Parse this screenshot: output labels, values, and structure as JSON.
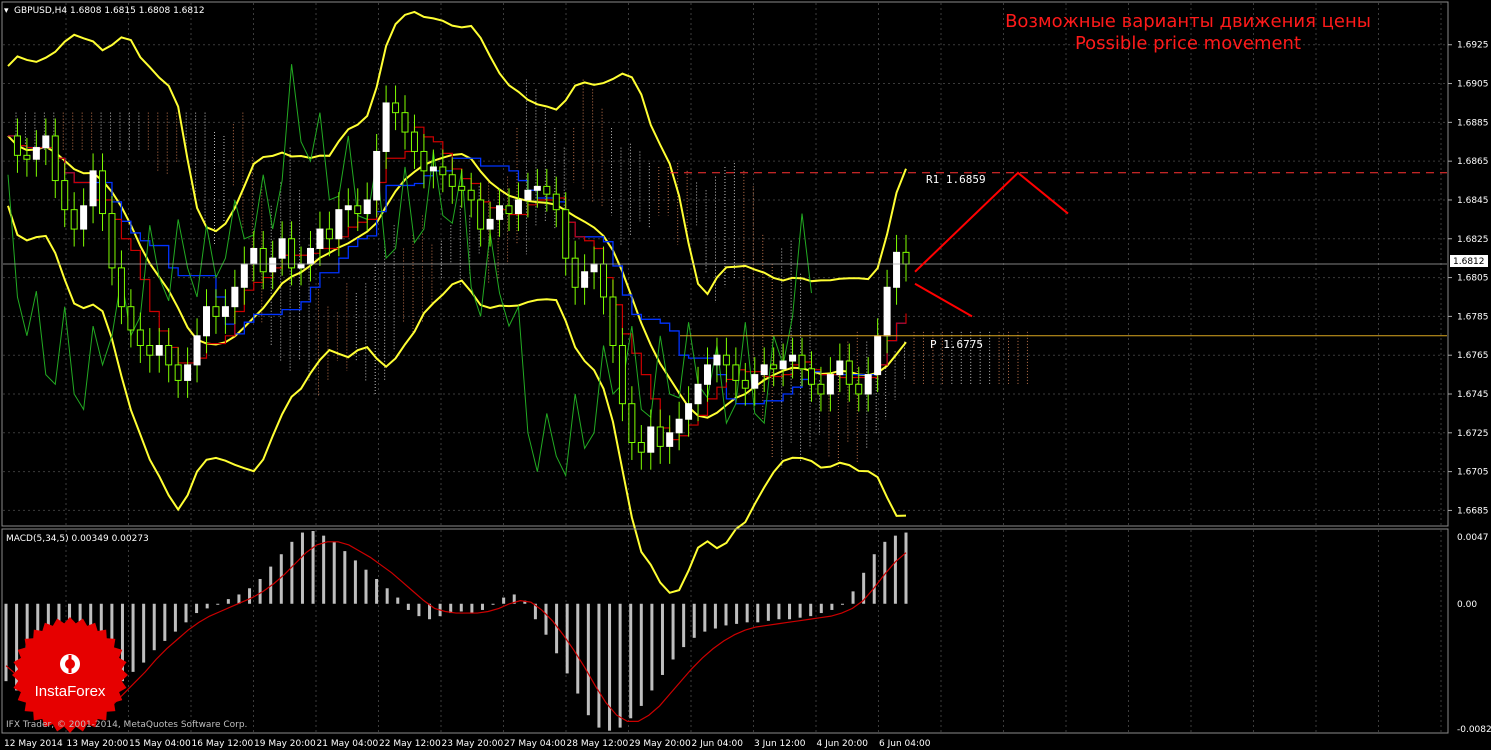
{
  "symbol_header": "GBPUSD,H4  1.6808 1.6815 1.6808 1.6812",
  "annotation": {
    "line1": "Возможные варианты движения цены",
    "line2": "Possible price movement"
  },
  "levels": [
    {
      "label": "R1 1.6859",
      "value": 1.6859,
      "color": "#ff3333",
      "style": "dashed"
    },
    {
      "label": "P 1.6775",
      "value": 1.6775,
      "color": "#d9a520",
      "style": "solid"
    }
  ],
  "current_price": {
    "label": "1.6812",
    "value": 1.6812
  },
  "macd_header": "MACD(5,34,5) 0.00349 0.00273",
  "copyright": "IFX Trader, © 2001-2014, MetaQuotes Software Corp.",
  "logo_text": "InstaForex",
  "price_axis": [
    "1.6925",
    "1.6905",
    "1.6885",
    "1.6865",
    "1.6845",
    "1.6825",
    "1.6805",
    "1.6785",
    "1.6765",
    "1.6745",
    "1.6725",
    "1.6705",
    "1.6685"
  ],
  "macd_axis": [
    "0.0047",
    "0.00",
    "-0.00822"
  ],
  "time_axis": [
    "12 May 2014",
    "13 May 20:00",
    "15 May 04:00",
    "16 May 12:00",
    "19 May 20:00",
    "21 May 04:00",
    "22 May 12:00",
    "23 May 20:00",
    "27 May 04:00",
    "28 May 12:00",
    "29 May 20:00",
    "2 Jun 04:00",
    "3 Jun 12:00",
    "4 Jun 20:00",
    "6 Jun 04:00"
  ],
  "colors": {
    "background": "#000000",
    "grid": "#3b3b3b",
    "bull": "#ffffff",
    "bear": "#7fff00",
    "bollinger": "#ffff33",
    "kijun": "#0033ff",
    "tenkan": "#cc0000",
    "chikou": "#22aa22",
    "macd_hist": "#bfbfbf",
    "macd_signal": "#cc0000",
    "annotation": "#ff1a1a",
    "logo": "#e60000"
  },
  "chart_data": {
    "type": "candlestick",
    "price_ylim": [
      1.6678,
      1.6946
    ],
    "macd_ylim": [
      -0.00822,
      0.0047
    ],
    "price_series": [
      1.6878,
      1.6868,
      1.6866,
      1.6872,
      1.6878,
      1.6855,
      1.684,
      1.683,
      1.6842,
      1.686,
      1.6838,
      1.681,
      1.679,
      1.6778,
      1.677,
      1.6765,
      1.677,
      1.676,
      1.6752,
      1.676,
      1.6775,
      1.679,
      1.6785,
      1.679,
      1.68,
      1.6812,
      1.682,
      1.6808,
      1.6815,
      1.6825,
      1.681,
      1.6812,
      1.682,
      1.683,
      1.6825,
      1.684,
      1.6842,
      1.6838,
      1.6845,
      1.687,
      1.6895,
      1.689,
      1.688,
      1.687,
      1.686,
      1.6862,
      1.6858,
      1.6852,
      1.685,
      1.6845,
      1.683,
      1.6835,
      1.6842,
      1.6838,
      1.6845,
      1.685,
      1.6852,
      1.6848,
      1.684,
      1.6815,
      1.68,
      1.6808,
      1.6812,
      1.6795,
      1.677,
      1.674,
      1.672,
      1.6715,
      1.6728,
      1.6718,
      1.6725,
      1.6732,
      1.674,
      1.675,
      1.676,
      1.6765,
      1.676,
      1.6752,
      1.6748,
      1.6755,
      1.676,
      1.6758,
      1.6762,
      1.6765,
      1.6758,
      1.675,
      1.6745,
      1.6755,
      1.6762,
      1.675,
      1.6745,
      1.6755,
      1.6775,
      1.68,
      1.6818,
      1.6812
    ],
    "macd_histogram": [
      -0.005,
      -0.0056,
      -0.0058,
      -0.0062,
      -0.0066,
      -0.0068,
      -0.0072,
      -0.0074,
      -0.007,
      -0.0064,
      -0.0058,
      -0.005,
      -0.0044,
      -0.0038,
      -0.003,
      -0.0024,
      -0.0018,
      -0.0012,
      -0.0006,
      -0.0003,
      0.0,
      0.0003,
      0.0006,
      0.001,
      0.0016,
      0.0024,
      0.0032,
      0.004,
      0.0046,
      0.0047,
      0.0044,
      0.004,
      0.0034,
      0.0028,
      0.0022,
      0.0016,
      0.001,
      0.0004,
      -0.0004,
      -0.0008,
      -0.001,
      -0.0008,
      -0.0006,
      -0.0005,
      -0.0006,
      -0.0004,
      0.0,
      0.0004,
      0.0006,
      0.0002,
      -0.001,
      -0.002,
      -0.0032,
      -0.0045,
      -0.0058,
      -0.0072,
      -0.008,
      -0.0082,
      -0.008,
      -0.0074,
      -0.0066,
      -0.0056,
      -0.0046,
      -0.0036,
      -0.0028,
      -0.0022,
      -0.0018,
      -0.0016,
      -0.0014,
      -0.0013,
      -0.0012,
      -0.0012,
      -0.0011,
      -0.001,
      -0.001,
      -0.0009,
      -0.0008,
      -0.0006,
      -0.0004,
      0.0,
      0.0008,
      0.002,
      0.0032,
      0.004,
      0.0044,
      0.0046
    ],
    "macd_signal": [
      -0.004,
      -0.0046,
      -0.0052,
      -0.0058,
      -0.0064,
      -0.0068,
      -0.0072,
      -0.0074,
      -0.0073,
      -0.007,
      -0.0065,
      -0.0058,
      -0.0051,
      -0.0044,
      -0.0036,
      -0.0029,
      -0.0023,
      -0.0017,
      -0.0012,
      -0.0008,
      -0.0005,
      -0.0002,
      0.0001,
      0.0004,
      0.0008,
      0.0013,
      0.0019,
      0.0026,
      0.0033,
      0.0038,
      0.004,
      0.004,
      0.0038,
      0.0034,
      0.003,
      0.0025,
      0.002,
      0.0014,
      0.0008,
      0.0002,
      -0.0003,
      -0.0005,
      -0.0006,
      -0.0006,
      -0.0006,
      -0.0005,
      -0.0003,
      0.0,
      0.0002,
      0.0001,
      -0.0004,
      -0.0011,
      -0.002,
      -0.003,
      -0.0041,
      -0.0053,
      -0.0064,
      -0.0072,
      -0.0076,
      -0.0076,
      -0.0072,
      -0.0066,
      -0.0058,
      -0.005,
      -0.0042,
      -0.0035,
      -0.0029,
      -0.0024,
      -0.002,
      -0.0017,
      -0.0015,
      -0.0014,
      -0.0013,
      -0.0012,
      -0.0011,
      -0.001,
      -0.0009,
      -0.0008,
      -0.0006,
      -0.0003,
      0.0002,
      0.001,
      0.0019,
      0.0027,
      0.0033
    ],
    "scenario": [
      {
        "from": 1.6808,
        "to": 1.6859,
        "then": 1.6838,
        "direction": "up"
      },
      {
        "from": 1.6808,
        "to": 1.6785,
        "direction": "down"
      }
    ]
  }
}
